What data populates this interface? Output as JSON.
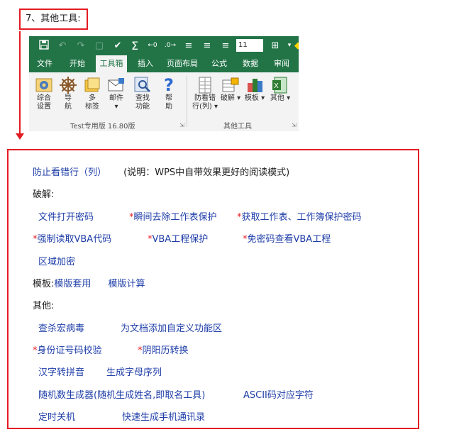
{
  "heading": "7、其他工具:",
  "qat": {
    "font_size_value": "11"
  },
  "tabs": [
    "文件",
    "开始",
    "工具箱",
    "插入",
    "页面布局",
    "公式",
    "数据",
    "审阅"
  ],
  "ribbon": {
    "tools": [
      "综合\n设置",
      "导\n航",
      "多\n标签",
      "邮件\n▾",
      "查找\n功能",
      "帮\n助",
      "防看错\n行(列) ▾",
      "破解 ▾",
      "模板 ▾",
      "其他 ▾"
    ],
    "groups": [
      "Test专用版 16.80版",
      "其他工具"
    ]
  },
  "list": {
    "row1_link": "防止看错行（列）",
    "row1_note": "(说明：WPS中自带效果更好的阅读模式)",
    "crack_label": "破解:",
    "crack_items": [
      "文件打开密码",
      "瞬间去除工作表保护",
      "获取工作表、工作簿保护密码",
      "强制读取VBA代码",
      "VBA工程保护",
      "免密码查看VBA工程",
      "区域加密"
    ],
    "template_label": "模板:",
    "template_items": [
      "模版套用",
      "模版计算"
    ],
    "other_label": "其他:",
    "other_items": [
      "查杀宏病毒",
      "为文档添加自定义功能区",
      "身份证号码校验",
      "阴阳历转换",
      "汉字转拼音",
      "生成字母序列",
      "随机数生成器(随机生成姓名,即取名工具)",
      "ASCII码对应字符",
      "定时关机",
      "快速生成手机通讯录"
    ],
    "star": "*"
  },
  "colors": {
    "accent_red": "#e31c23",
    "excel_green": "#227447",
    "link_blue": "#1f3ea8"
  }
}
